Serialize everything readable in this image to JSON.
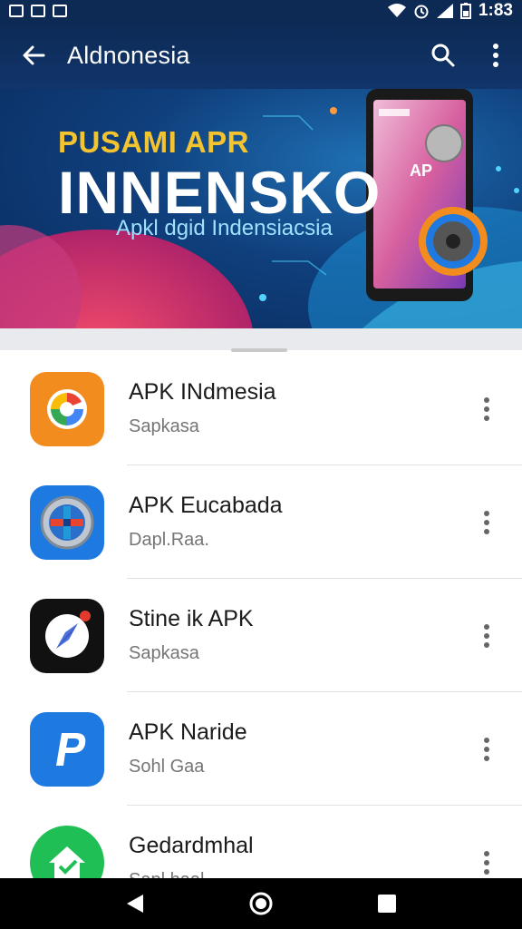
{
  "status": {
    "time": "1:83"
  },
  "appbar": {
    "title": "Aldnonesia"
  },
  "banner": {
    "subtitle_top": "PUSAMI APR",
    "title": "INNENSKO",
    "subtitle_bottom": "Apkl dgid Indensiacsia",
    "phone_label": "AP"
  },
  "apps": [
    {
      "name": "APK INdmesia",
      "subtitle": "Sapkasa",
      "icon": "google-style-icon"
    },
    {
      "name": "APK Eucabada",
      "subtitle": "Dapl.Raa.",
      "icon": "plus-grid-icon"
    },
    {
      "name": "Stine ik APK",
      "subtitle": "Sapkasa",
      "icon": "compass-icon"
    },
    {
      "name": "APK Naride",
      "subtitle": "Sohl Gaa",
      "icon": "p-letter-icon"
    },
    {
      "name": "Gedardmhal",
      "subtitle": "Sapl.haal",
      "icon": "home-icon"
    }
  ],
  "colors": {
    "appbar": "#0d2a55",
    "accent_orange": "#f28c1e",
    "accent_blue": "#1e7ae0",
    "accent_green": "#1fbf55"
  }
}
